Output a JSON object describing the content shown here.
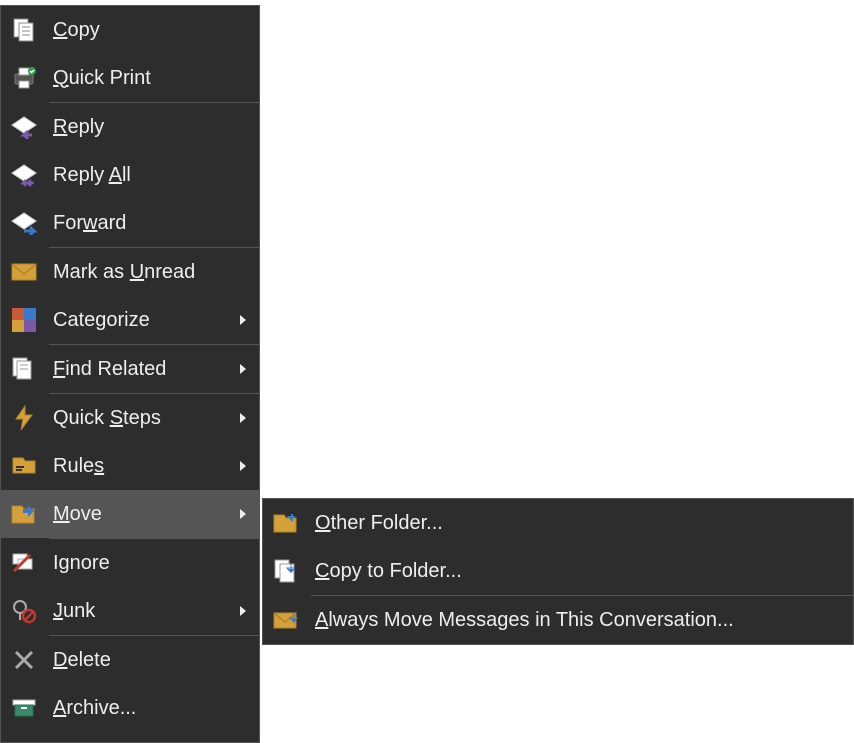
{
  "main_menu": [
    {
      "id": "copy",
      "text": "Copy",
      "u": 0,
      "arrow": false,
      "sep": false
    },
    {
      "id": "quick-print",
      "text": "Quick Print",
      "u": 0,
      "arrow": false,
      "sep": true
    },
    {
      "id": "reply",
      "text": "Reply",
      "u": 0,
      "arrow": false,
      "sep": false
    },
    {
      "id": "reply-all",
      "text": "Reply All",
      "u": 6,
      "arrow": false,
      "sep": false
    },
    {
      "id": "forward",
      "text": "Forward",
      "u": 3,
      "arrow": false,
      "sep": true
    },
    {
      "id": "mark-unread",
      "text": "Mark as Unread",
      "u": 8,
      "arrow": false,
      "sep": false
    },
    {
      "id": "categorize",
      "text": "Categorize",
      "u": -1,
      "arrow": true,
      "sep": true
    },
    {
      "id": "find-related",
      "text": "Find Related",
      "u": 0,
      "arrow": true,
      "sep": true
    },
    {
      "id": "quick-steps",
      "text": "Quick Steps",
      "u": 6,
      "arrow": true,
      "sep": false
    },
    {
      "id": "rules",
      "text": "Rules",
      "u": 4,
      "arrow": true,
      "sep": false
    },
    {
      "id": "move",
      "text": "Move",
      "u": 0,
      "arrow": true,
      "sep": true,
      "hover": true
    },
    {
      "id": "ignore",
      "text": "Ignore",
      "u": -1,
      "arrow": false,
      "sep": false
    },
    {
      "id": "junk",
      "text": "Junk",
      "u": 0,
      "arrow": true,
      "sep": true
    },
    {
      "id": "delete",
      "text": "Delete",
      "u": 0,
      "arrow": false,
      "sep": false
    },
    {
      "id": "archive",
      "text": "Archive...",
      "u": 0,
      "arrow": false,
      "sep": false
    }
  ],
  "sub_menu": [
    {
      "id": "other-folder",
      "text": "Other Folder...",
      "u": 0,
      "sep": false
    },
    {
      "id": "copy-folder",
      "text": "Copy to Folder...",
      "u": 0,
      "sep": true
    },
    {
      "id": "always-move",
      "text": "Always Move Messages in This Conversation...",
      "u": 0,
      "sep": false
    }
  ]
}
